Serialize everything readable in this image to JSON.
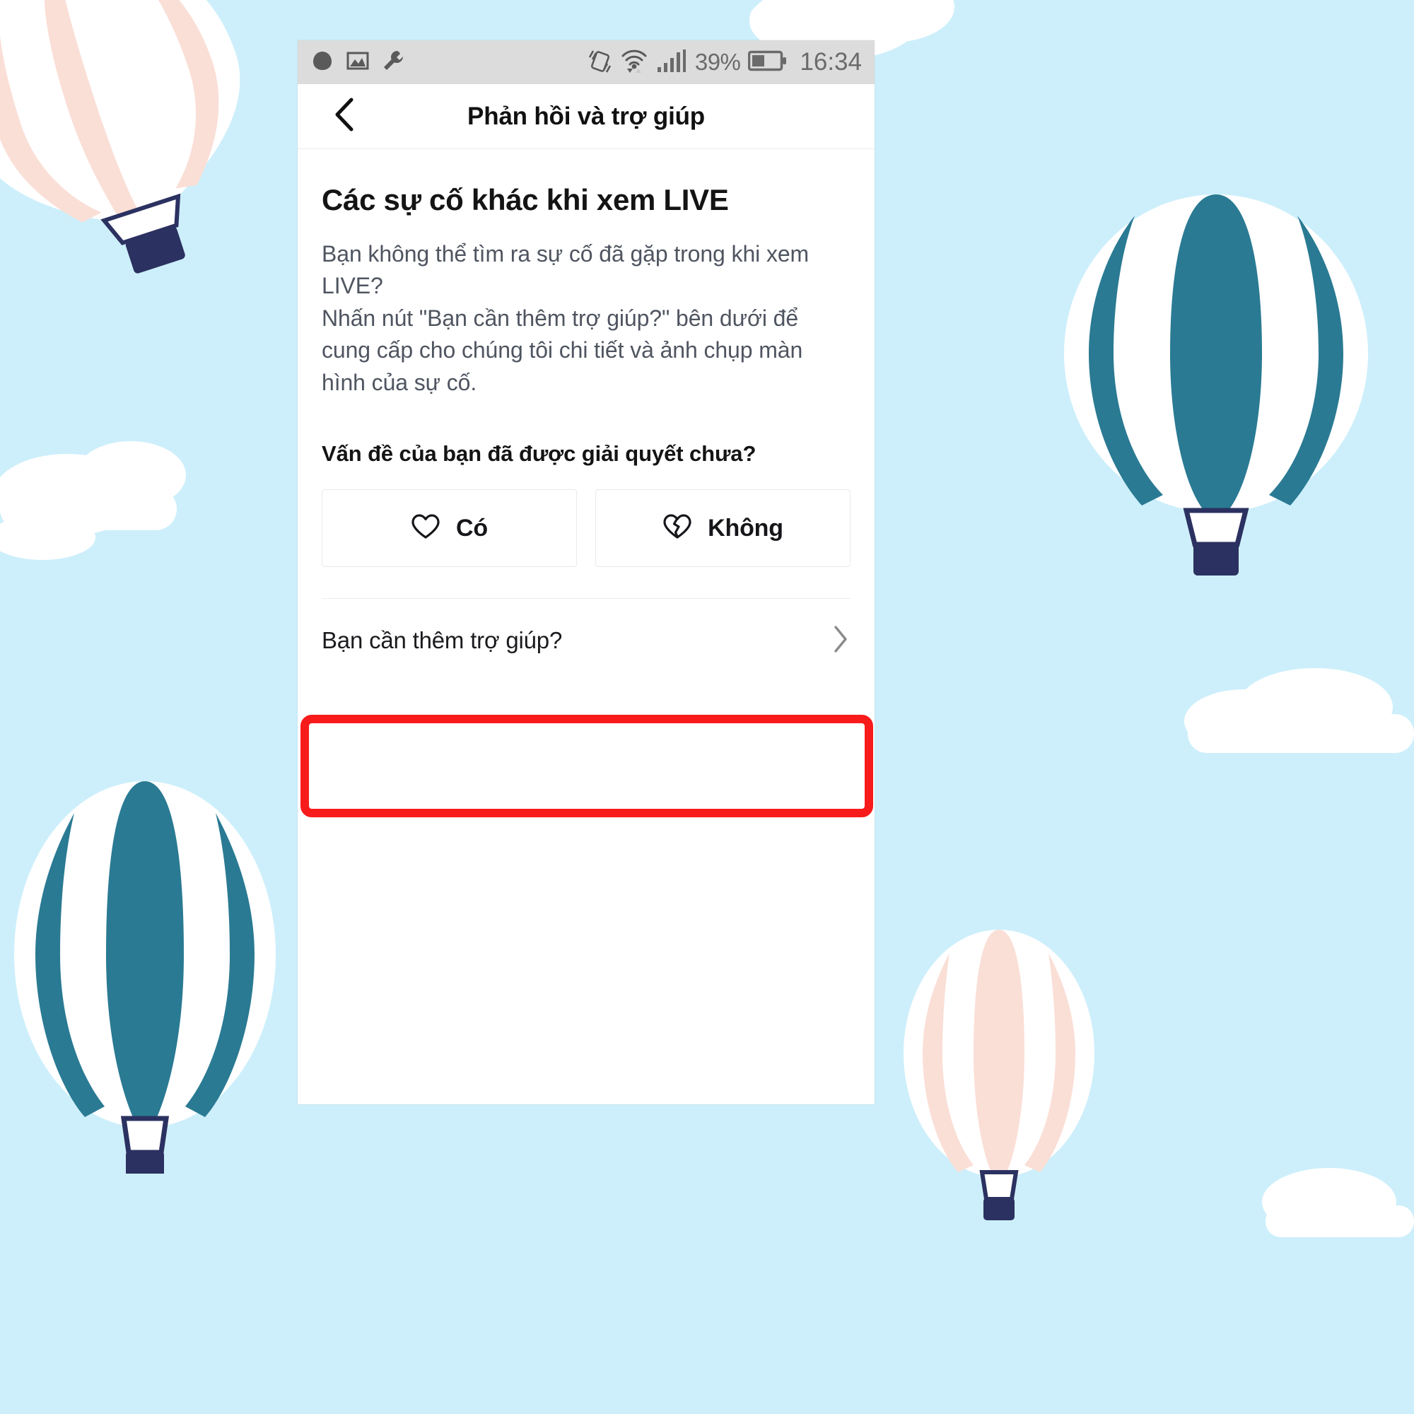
{
  "statusbar": {
    "left_icons": [
      "notification-dot-icon",
      "image-icon",
      "wrench-icon"
    ],
    "right_icons": [
      "screen-rotation-icon",
      "wifi-icon",
      "signal-bars-icon",
      "battery-icon"
    ],
    "battery_percent": "39%",
    "clock": "16:34"
  },
  "navbar": {
    "back_icon": "chevron-left-icon",
    "title": "Phản hồi và trợ giúp"
  },
  "content": {
    "heading": "Các sự cố khác khi xem LIVE",
    "body": "Bạn không thể tìm ra sự cố đã gặp trong khi xem LIVE?\nNhấn nút \"Bạn cần thêm trợ giúp?\" bên dưới để cung cấp cho chúng tôi chi tiết và ảnh chụp màn hình của sự cố.",
    "resolve_question": "Vấn đề của bạn đã được giải quyết chưa?",
    "feedback_buttons": [
      {
        "label": "Có",
        "icon": "heart-outline-icon"
      },
      {
        "label": "Không",
        "icon": "broken-heart-icon"
      }
    ],
    "more_help": {
      "label": "Bạn cần thêm trợ giúp?",
      "chevron": "chevron-right-icon"
    }
  },
  "annotation": {
    "highlight_color": "#f81b1b",
    "highlight_target": "more-help-row"
  },
  "background": {
    "sky_color": "#cdeffb",
    "cloud_color": "#ffffff",
    "balloon_teal": "#2a7a93",
    "balloon_peach": "#fadfd6",
    "balloon_basket": "#2b3160"
  }
}
